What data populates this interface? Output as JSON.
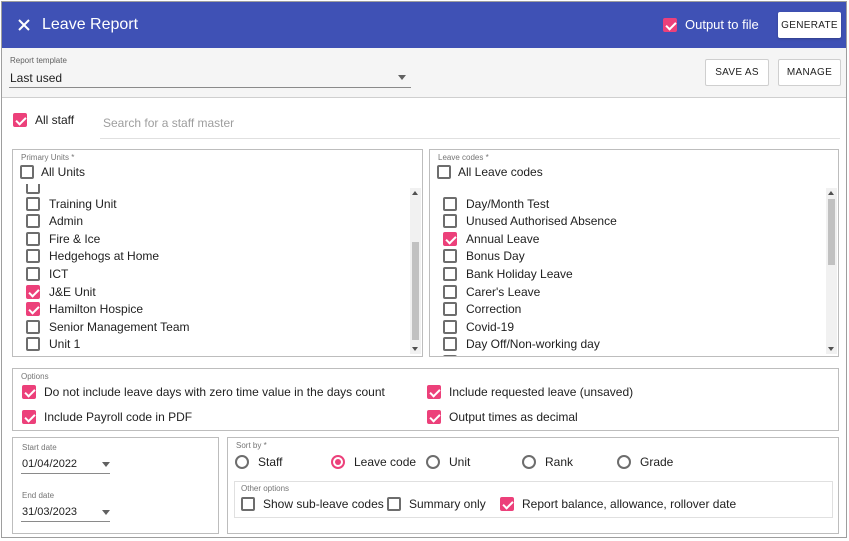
{
  "header": {
    "title": "Leave Report",
    "output_to_file_label": "Output to file",
    "output_to_file_checked": true,
    "generate_label": "GENERATE",
    "background": "#3f51b5"
  },
  "template": {
    "label": "Report template",
    "value": "Last used",
    "save_as_label": "SAVE AS",
    "manage_label": "MANAGE"
  },
  "staff": {
    "all_staff_label": "All staff",
    "all_staff_checked": true,
    "search_placeholder": "Search for a staff master"
  },
  "units": {
    "legend": "Primary Units *",
    "all_label": "All Units",
    "all_checked": false,
    "items": [
      {
        "label": "Training Unit",
        "checked": false
      },
      {
        "label": "Admin",
        "checked": false
      },
      {
        "label": "Fire & Ice",
        "checked": false
      },
      {
        "label": "Hedgehogs at Home",
        "checked": false
      },
      {
        "label": "ICT",
        "checked": false
      },
      {
        "label": "J&E Unit",
        "checked": true
      },
      {
        "label": "Hamilton Hospice",
        "checked": true
      },
      {
        "label": "Senior Management Team",
        "checked": false
      },
      {
        "label": "Unit 1",
        "checked": false
      }
    ],
    "scroll_fraction": 0.75
  },
  "leave_codes": {
    "legend": "Leave codes *",
    "all_label": "All Leave codes",
    "all_checked": false,
    "items": [
      {
        "label": "Day/Month Test",
        "checked": false
      },
      {
        "label": "Unused Authorised Absence",
        "checked": false
      },
      {
        "label": "Annual Leave",
        "checked": true
      },
      {
        "label": "Bonus Day",
        "checked": false
      },
      {
        "label": "Bank Holiday Leave",
        "checked": false
      },
      {
        "label": "Carer's Leave",
        "checked": false
      },
      {
        "label": "Correction",
        "checked": false
      },
      {
        "label": "Covid-19",
        "checked": false
      },
      {
        "label": "Day Off/Non-working day",
        "checked": false
      }
    ],
    "scroll_fraction": 0.0
  },
  "options": {
    "legend": "Options",
    "zero_time_label": "Do not include leave days with zero time value in the days count",
    "zero_time_checked": true,
    "requested_label": "Include requested leave (unsaved)",
    "requested_checked": true,
    "payroll_label": "Include Payroll code in PDF",
    "payroll_checked": true,
    "decimal_label": "Output times as decimal",
    "decimal_checked": true
  },
  "dates": {
    "start_label": "Start date",
    "start_value": "01/04/2022",
    "end_label": "End date",
    "end_value": "31/03/2023"
  },
  "sort": {
    "legend": "Sort by *",
    "options": [
      "Staff",
      "Leave code",
      "Unit",
      "Rank",
      "Grade"
    ],
    "selected": "Leave code"
  },
  "other_options": {
    "legend": "Other options",
    "sub_leave_label": "Show sub-leave codes",
    "sub_leave_checked": false,
    "summary_label": "Summary only",
    "summary_checked": false,
    "balance_label": "Report balance, allowance, rollover date",
    "balance_checked": true
  },
  "colors": {
    "accent": "#ec407a",
    "header": "#3f51b5"
  }
}
